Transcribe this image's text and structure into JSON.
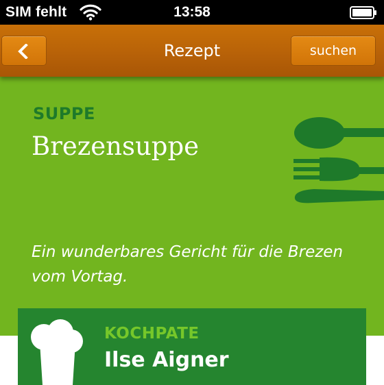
{
  "status_bar": {
    "carrier": "SIM fehlt",
    "time": "13:58",
    "wifi_icon": "wifi-icon",
    "battery_icon": "battery-icon"
  },
  "nav": {
    "title": "Rezept",
    "back_icon": "chevron-left-icon",
    "search_label": "suchen",
    "bar_color": "#b86208",
    "button_color": "#d97a0c"
  },
  "recipe": {
    "category": "SUPPE",
    "title": "Brezensuppe",
    "description": "Ein wunderbares Gericht für die Brezen vom Vortag.",
    "icon": "cutlery-icon",
    "background_color": "#72b51f",
    "accent_color": "#1e7a2a"
  },
  "cook": {
    "label": "KOCHPATE",
    "name": "Ilse Aigner",
    "icon": "chef-hat-icon",
    "card_color": "#25852f",
    "label_color": "#76c72a"
  }
}
